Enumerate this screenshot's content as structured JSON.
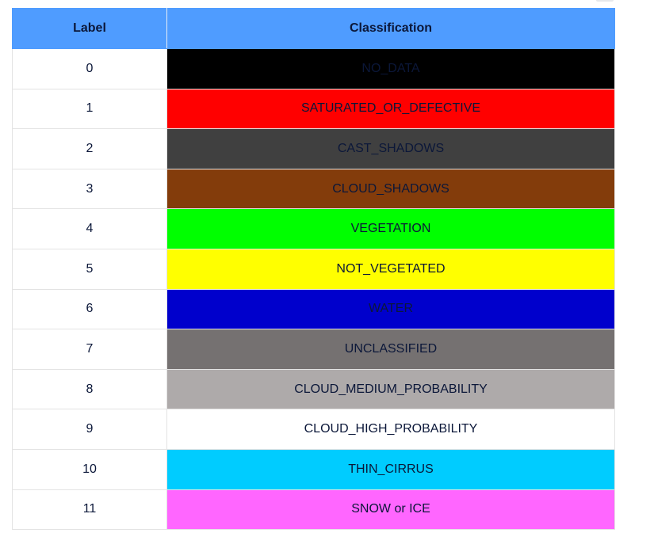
{
  "table": {
    "headers": {
      "label": "Label",
      "classification": "Classification"
    },
    "rows": [
      {
        "label": "0",
        "classification": "NO_DATA",
        "color": "#000000"
      },
      {
        "label": "1",
        "classification": "SATURATED_OR_DEFECTIVE",
        "color": "#ff0000"
      },
      {
        "label": "2",
        "classification": "CAST_SHADOWS",
        "color": "#404040"
      },
      {
        "label": "3",
        "classification": "CLOUD_SHADOWS",
        "color": "#833c0b"
      },
      {
        "label": "4",
        "classification": "VEGETATION",
        "color": "#00ff00"
      },
      {
        "label": "5",
        "classification": "NOT_VEGETATED",
        "color": "#ffff00"
      },
      {
        "label": "6",
        "classification": "WATER",
        "color": "#0000cc"
      },
      {
        "label": "7",
        "classification": "UNCLASSIFIED",
        "color": "#757171"
      },
      {
        "label": "8",
        "classification": "CLOUD_MEDIUM_PROBABILITY",
        "color": "#aeaaaa"
      },
      {
        "label": "9",
        "classification": "CLOUD_HIGH_PROBABILITY",
        "color": "#ffffff"
      },
      {
        "label": "10",
        "classification": "THIN_CIRRUS",
        "color": "#00ccff"
      },
      {
        "label": "11",
        "classification": "SNOW or ICE",
        "color": "#ff66ff"
      }
    ],
    "text_color": "#0b1739",
    "header_color": "#4f9cff"
  }
}
